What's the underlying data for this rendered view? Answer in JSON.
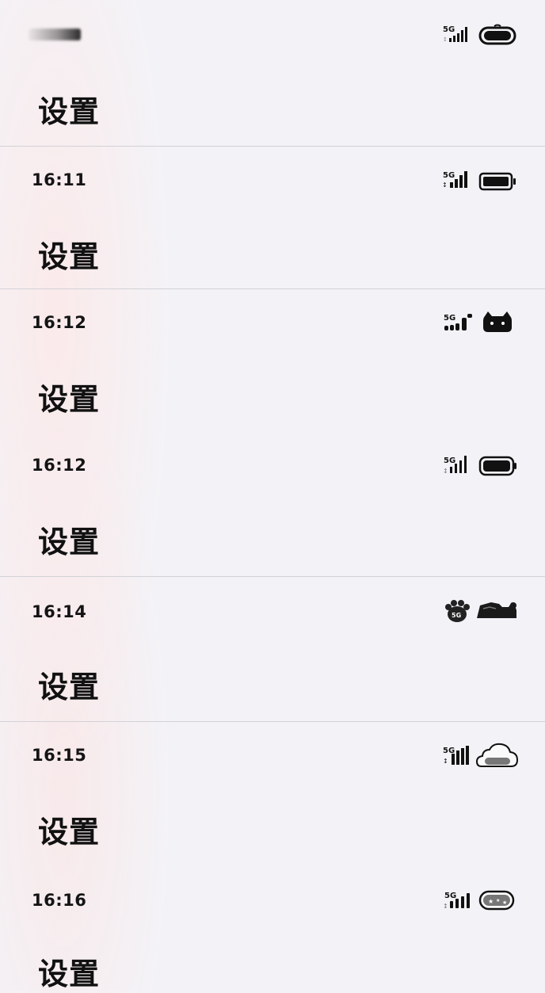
{
  "title_text": "设置",
  "panels": [
    {
      "time": "",
      "network": "5G",
      "battery_style": "rounded-pill"
    },
    {
      "time": "16:11",
      "network": "5G",
      "battery_style": "classic"
    },
    {
      "time": "16:12",
      "network": "5G",
      "battery_style": "cat"
    },
    {
      "time": "16:12",
      "network": "5G",
      "battery_style": "classic-outline"
    },
    {
      "time": "16:14",
      "network": "5G",
      "battery_style": "paw-and-cats"
    },
    {
      "time": "16:15",
      "network": "5G",
      "battery_style": "cloud"
    },
    {
      "time": "16:16",
      "network": "5G",
      "battery_style": "starry-pill"
    }
  ]
}
